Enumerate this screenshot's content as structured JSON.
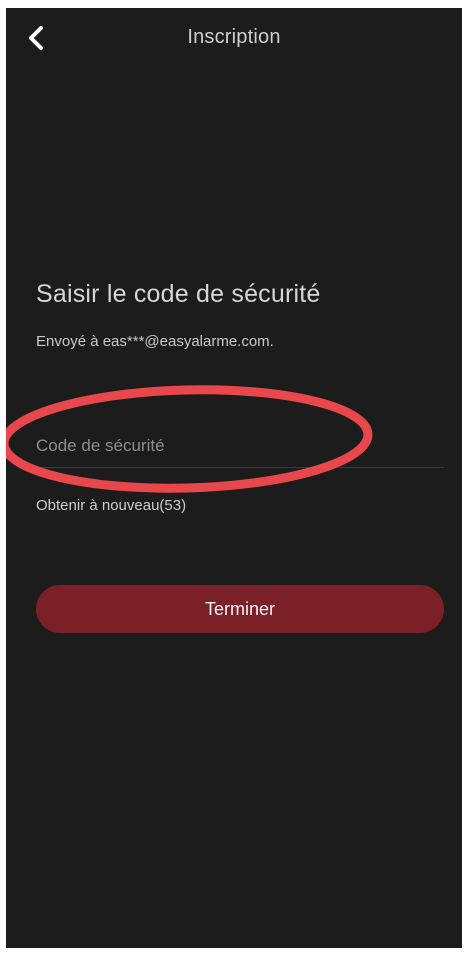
{
  "header": {
    "title": "Inscription",
    "back_icon": "chevron-left-icon"
  },
  "main": {
    "heading": "Saisir le code de sécurité",
    "sent_to": "Envoyé à eas***@easyalarme.com.",
    "code_field": {
      "placeholder": "Code de sécurité",
      "value": ""
    },
    "resend_label": "Obtenir à nouveau(53)",
    "finish_label": "Terminer"
  },
  "annotation": {
    "shape": "ellipse",
    "color": "#e8474c"
  },
  "colors": {
    "background": "#1c1c1c",
    "accent": "#7c2028",
    "text": "#d6d6d6"
  }
}
